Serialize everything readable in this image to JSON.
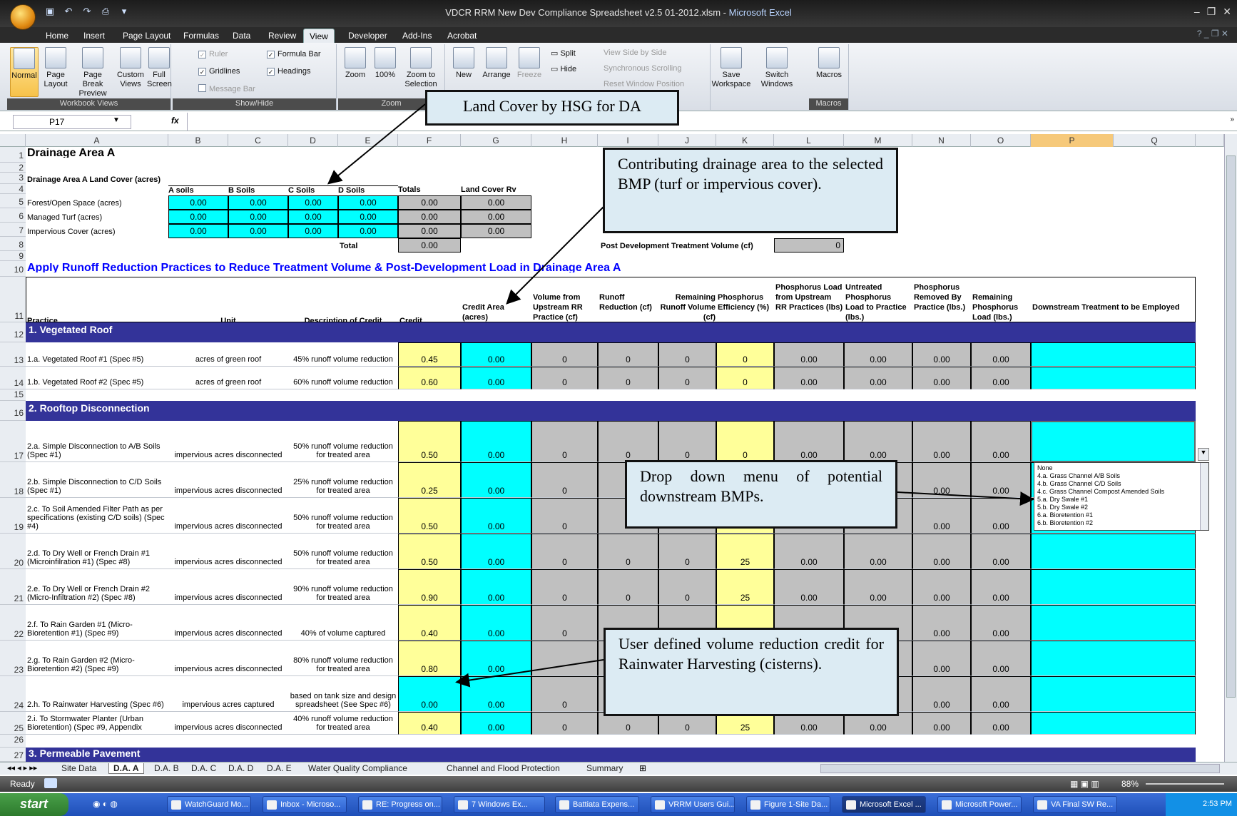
{
  "window": {
    "title": "VDCR RRM New Dev Compliance Spreadsheet v2.5 01-2012.xlsm",
    "app": "Microsoft Excel",
    "orb": "Ctrl"
  },
  "ribbon_tabs": [
    "Home",
    "Insert",
    "Page Layout",
    "Formulas",
    "Data",
    "Review",
    "View",
    "Developer",
    "Add-Ins",
    "Acrobat"
  ],
  "ribbon": {
    "workbook_views": {
      "label": "Workbook Views",
      "normal": "Normal",
      "page_layout": "Page Layout",
      "page_break": "Page Break Preview",
      "custom": "Custom Views",
      "full": "Full Screen"
    },
    "show_hide": {
      "label": "Show/Hide",
      "ruler": "Ruler",
      "gridlines": "Gridlines",
      "message_bar": "Message Bar",
      "formula_bar": "Formula Bar",
      "headings": "Headings"
    },
    "zoom": {
      "label": "Zoom",
      "zoom": "Zoom",
      "p100": "100%",
      "zoom_sel": "Zoom to Selection"
    },
    "window": {
      "new": "New",
      "arrange": "Arrange",
      "freeze": "Freeze",
      "split": "Split",
      "hide": "Hide",
      "side": "View Side by Side",
      "sync": "Synchronous Scrolling",
      "reset": "Reset Window Position",
      "save": "Save Workspace",
      "switch": "Switch Windows"
    },
    "macros": {
      "label": "Macros",
      "macros": "Macros"
    }
  },
  "namebox": "P17",
  "fx": "fx",
  "columns": [
    "A",
    "B",
    "C",
    "D",
    "E",
    "F",
    "G",
    "H",
    "I",
    "J",
    "K",
    "L",
    "M",
    "N",
    "O",
    "P",
    "Q"
  ],
  "rows": [
    "1",
    "2",
    "3",
    "4",
    "5",
    "6",
    "7",
    "8",
    "9",
    "10",
    "11",
    "12",
    "13",
    "14",
    "15",
    "16",
    "17",
    "18",
    "19",
    "20",
    "21",
    "22",
    "23",
    "24",
    "25",
    "26",
    "27"
  ],
  "sheet": {
    "title": "Drainage Area A",
    "lc_title": "Drainage Area A Land Cover (acres)",
    "lc_headers": [
      "A soils",
      "B Soils",
      "C Soils",
      "D Soils",
      "Totals",
      "Land Cover Rv"
    ],
    "lc_rows": [
      {
        "label": "Forest/Open Space (acres)",
        "vals": [
          "0.00",
          "0.00",
          "0.00",
          "0.00",
          "0.00",
          "0.00"
        ]
      },
      {
        "label": "Managed Turf (acres)",
        "vals": [
          "0.00",
          "0.00",
          "0.00",
          "0.00",
          "0.00",
          "0.00"
        ]
      },
      {
        "label": "Impervious Cover (acres)",
        "vals": [
          "0.00",
          "0.00",
          "0.00",
          "0.00",
          "0.00",
          "0.00"
        ]
      }
    ],
    "total_label": "Total",
    "total_val": "0.00",
    "ptv_label": "Post Development Treatment Volume (cf)",
    "ptv_val": "0",
    "apply_title": "Apply Runoff Reduction Practices to Reduce Treatment Volume & Post-Development Load in Drainage Area A",
    "headers": {
      "practice": "Practice",
      "unit": "Unit",
      "desc": "Description of Credit",
      "credit": "Credit",
      "area": "Credit Area (acres)",
      "vol": "Volume from Upstream RR Practice (cf)",
      "rr": "Runoff Reduction (cf)",
      "rem": "Remaining Runoff Volume (cf)",
      "eff": "Phosphorus Efficiency (%)",
      "pl": "Phosphorus Load from Upstream RR Practices (lbs)",
      "unt": "Untreated Phosphorus Load to Practice (lbs.)",
      "rmv": "Phosphorus Removed By Practice (lbs.)",
      "remp": "Remaining Phosphorus Load (lbs.)",
      "down": "Downstream Treatment to be Employed"
    },
    "sec1": "1. Vegetated Roof",
    "sec2": "2. Rooftop Disconnection",
    "sec3": "3. Permeable Pavement",
    "practices": [
      {
        "practice": "1.a. Vegetated Roof #1 (Spec #5)",
        "unit": "acres of green roof",
        "desc": "45% runoff volume reduction",
        "credit": "0.45",
        "area": "0.00",
        "vol": "0",
        "rr": "0",
        "rem": "0",
        "eff": "0",
        "pl": "0.00",
        "unt": "0.00",
        "rmv": "0.00",
        "remp": "0.00"
      },
      {
        "practice": "1.b. Vegetated Roof #2 (Spec #5)",
        "unit": "acres of green roof",
        "desc": "60% runoff volume reduction",
        "credit": "0.60",
        "area": "0.00",
        "vol": "0",
        "rr": "0",
        "rem": "0",
        "eff": "0",
        "pl": "0.00",
        "unt": "0.00",
        "rmv": "0.00",
        "remp": "0.00"
      },
      {
        "practice": "2.a. Simple Disconnection to A/B Soils (Spec #1)",
        "unit": "impervious acres disconnected",
        "desc": "50% runoff volume reduction for treated area",
        "credit": "0.50",
        "area": "0.00",
        "vol": "0",
        "rr": "0",
        "rem": "0",
        "eff": "0",
        "pl": "0.00",
        "unt": "0.00",
        "rmv": "0.00",
        "remp": "0.00"
      },
      {
        "practice": "2.b. Simple Disconnection to C/D Soils (Spec #1)",
        "unit": "impervious acres disconnected",
        "desc": "25% runoff volume reduction for treated area",
        "credit": "0.25",
        "area": "0.00",
        "vol": "0",
        "rr": "",
        "rem": "",
        "eff": "",
        "pl": "",
        "unt": "",
        "rmv": "0.00",
        "remp": "0.00"
      },
      {
        "practice": "2.c. To Soil Amended Filter Path as per specifications (existing C/D soils) (Spec #4)",
        "unit": "impervious acres disconnected",
        "desc": "50% runoff volume reduction for treated area",
        "credit": "0.50",
        "area": "0.00",
        "vol": "0",
        "rr": "",
        "rem": "",
        "eff": "",
        "pl": "",
        "unt": "",
        "rmv": "0.00",
        "remp": "0.00"
      },
      {
        "practice": "2.d. To Dry Well or French Drain #1 (Microinfilration #1) (Spec #8)",
        "unit": "impervious acres disconnected",
        "desc": "50% runoff volume reduction for treated area",
        "credit": "0.50",
        "area": "0.00",
        "vol": "0",
        "rr": "0",
        "rem": "0",
        "eff": "25",
        "pl": "0.00",
        "unt": "0.00",
        "rmv": "0.00",
        "remp": "0.00"
      },
      {
        "practice": "2.e. To Dry Well or French Drain #2 (Micro-Infiltration #2) (Spec #8)",
        "unit": "impervious acres disconnected",
        "desc": "90% runoff volume reduction for treated area",
        "credit": "0.90",
        "area": "0.00",
        "vol": "0",
        "rr": "0",
        "rem": "0",
        "eff": "25",
        "pl": "0.00",
        "unt": "0.00",
        "rmv": "0.00",
        "remp": "0.00"
      },
      {
        "practice": "2.f. To Rain Garden #1 (Micro-Bioretention #1) (Spec #9)",
        "unit": "impervious acres disconnected",
        "desc": "40% of volume captured",
        "credit": "0.40",
        "area": "0.00",
        "vol": "0",
        "rr": "",
        "rem": "",
        "eff": "",
        "pl": "",
        "unt": "",
        "rmv": "0.00",
        "remp": "0.00"
      },
      {
        "practice": "2.g. To Rain Garden #2 (Micro-Bioretention #2) (Spec #9)",
        "unit": "impervious acres disconnected",
        "desc": "80% runoff volume reduction for treated area",
        "credit": "0.80",
        "area": "0.00",
        "vol": "",
        "rr": "",
        "rem": "",
        "eff": "",
        "pl": "",
        "unt": "",
        "rmv": "0.00",
        "remp": "0.00"
      },
      {
        "practice": "2.h. To Rainwater Harvesting (Spec #6)",
        "unit": "impervious acres captured",
        "desc": "based on tank size and design spreadsheet (See Spec #6)",
        "credit": "0.00",
        "area": "0.00",
        "vol": "0",
        "rr": "",
        "rem": "",
        "eff": "",
        "pl": "",
        "unt": "",
        "rmv": "0.00",
        "remp": "0.00"
      },
      {
        "practice": "2.i. To Stormwater Planter (Urban Bioretention) (Spec #9, Appendix",
        "unit": "impervious acres disconnected",
        "desc": "40% runoff volume reduction for treated area",
        "credit": "0.40",
        "area": "0.00",
        "vol": "0",
        "rr": "0",
        "rem": "0",
        "eff": "25",
        "pl": "0.00",
        "unt": "0.00",
        "rmv": "0.00",
        "remp": "0.00"
      }
    ]
  },
  "dropdown_options": [
    "None",
    "4.a. Grass Channel A/B Soils",
    "4.b. Grass Channel C/D Soils",
    "4.c. Grass Channel Compost Amended Soils",
    "5.a. Dry Swale #1",
    "5.b. Dry Swale #2",
    "6.a. Bioretention #1",
    "6.b. Bioretention #2"
  ],
  "callouts": {
    "land_cover": "Land Cover by HSG for DA",
    "contrib": "Contributing drainage area to the selected BMP (turf or impervious cover).",
    "dropdown": "Drop down menu of potential downstream BMPs.",
    "user_defined": "User defined volume reduction credit for Rainwater Harvesting (cisterns)."
  },
  "sheet_tabs": [
    "Site Data",
    "D.A. A",
    "D.A. B",
    "D.A. C",
    "D.A. D",
    "D.A. E",
    "Water Quality Compliance",
    "Channel and Flood Protection",
    "Summary"
  ],
  "status": {
    "ready": "Ready",
    "zoom": "88%"
  },
  "taskbar": {
    "start": "start",
    "items": [
      "WatchGuard Mo...",
      "Inbox - Microso...",
      "RE: Progress on...",
      "7 Windows Ex...",
      "Battiata Expens...",
      "VRRM Users Gui...",
      "Figure 1-Site Da...",
      "Microsoft Excel ...",
      "Microsoft Power...",
      "VA Final SW Re..."
    ],
    "clock": "2:53 PM"
  }
}
